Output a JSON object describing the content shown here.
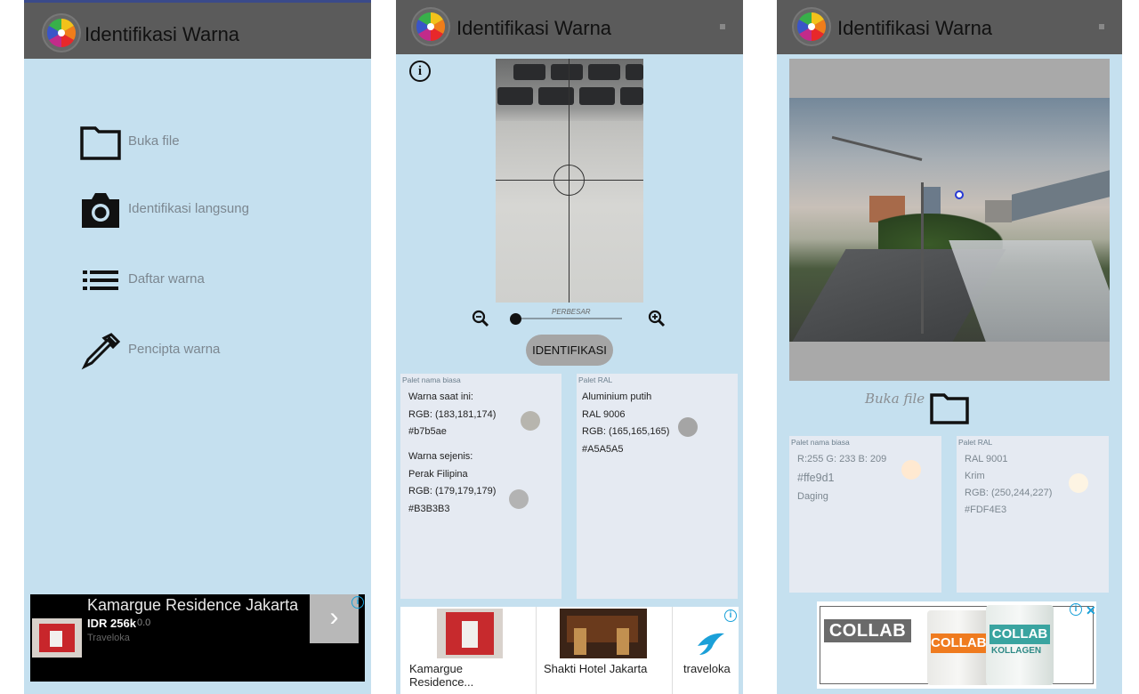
{
  "app": {
    "title": "Identifikasi Warna"
  },
  "screen1": {
    "menu": [
      {
        "label": "Buka file",
        "icon": "folder-icon"
      },
      {
        "label": "Identifikasi langsung",
        "icon": "camera-icon"
      },
      {
        "label": "Daftar warna",
        "icon": "list-icon"
      },
      {
        "label": "Pencipta warna",
        "icon": "eyedropper-icon"
      }
    ],
    "ad": {
      "title": "Kamargue Residence Jakarta",
      "price": "IDR 256k",
      "rating": "0.0",
      "brand": "Traveloka",
      "cta": "›"
    }
  },
  "screen2": {
    "zoom_label": "PERBESAR",
    "zoom_level": 0.0,
    "identify_label": "IDENTIFIKASI",
    "palette_common": {
      "header": "Palet nama biasa",
      "current_label": "Warna saat ini:",
      "current_rgb": "RGB: (183,181,174)",
      "current_hex": "#b7b5ae",
      "similar_label": "Warna sejenis:",
      "similar_name": "Perak Filipina",
      "similar_rgb": "RGB: (179,179,179)",
      "similar_hex": "#B3B3B3",
      "current_swatch": "#b7b5ae",
      "similar_swatch": "#b3b3b3"
    },
    "palette_ral": {
      "header": "Palet RAL",
      "name": "Aluminium putih",
      "code": "RAL 9006",
      "rgb": "RGB: (165,165,165)",
      "hex": "#A5A5A5",
      "swatch": "#a5a5a5"
    },
    "ad": {
      "cards": [
        {
          "text": "Kamargue Residence..."
        },
        {
          "text": "Shakti Hotel Jakarta"
        },
        {
          "text": "traveloka"
        }
      ]
    }
  },
  "screen3": {
    "open_file_label": "Buka file",
    "palette_common": {
      "header": "Palet nama biasa",
      "rgb": "R:255 G: 233 B: 209",
      "hex": "#ffe9d1",
      "name": "Daging",
      "swatch": "#ffe9d1"
    },
    "palette_ral": {
      "header": "Palet RAL",
      "code": "RAL 9001",
      "name": "Krim",
      "rgb": "RGB: (250,244,227)",
      "hex": "#FDF4E3",
      "swatch": "#fdf4e3"
    },
    "ad": {
      "brand": "COLLAB",
      "can_text_1": "COLLAB",
      "can_text_2": "COLLAB",
      "can_sub": "KOLLAGEN",
      "close": "✕"
    }
  },
  "colors": {
    "background": "#c5e0ef",
    "appbar": "#5b5b5b",
    "panel": "#e5eaf2",
    "ad_info": "#19a0d8"
  }
}
